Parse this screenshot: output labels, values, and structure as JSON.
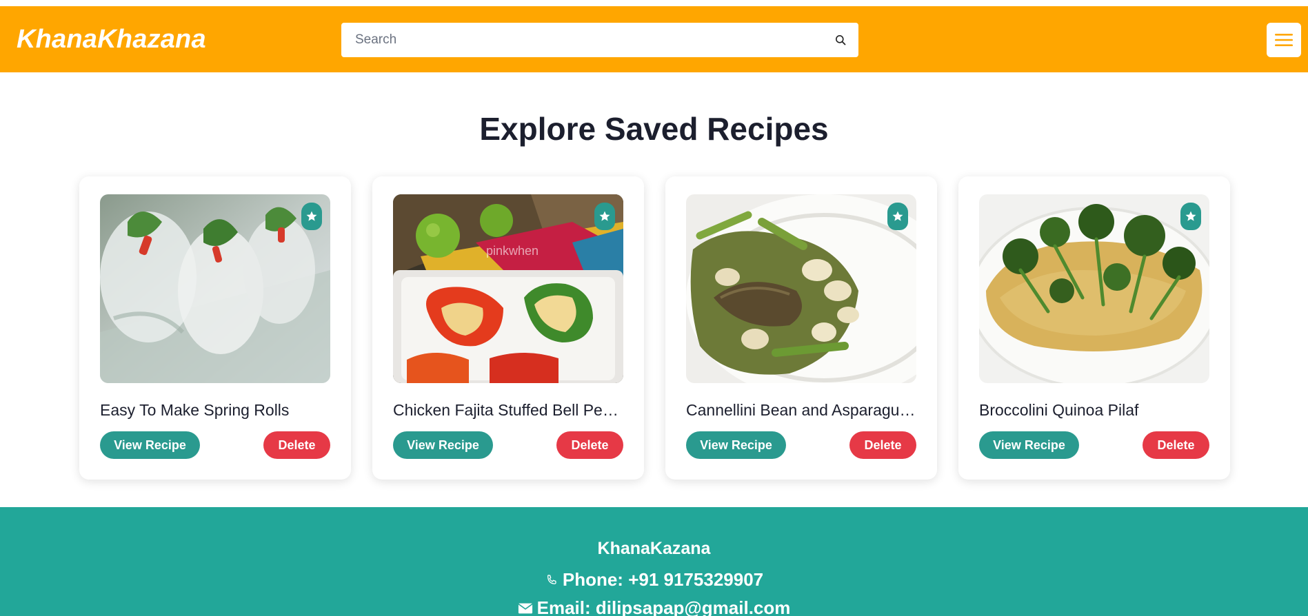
{
  "header": {
    "brand": "KhanaKhazana",
    "search_placeholder": "Search",
    "search_icon": "search-icon",
    "menu_icon": "hamburger-menu-icon"
  },
  "main": {
    "title": "Explore Saved Recipes",
    "cards": [
      {
        "title": "Easy To Make Spring Rolls",
        "view_label": "View Recipe",
        "delete_label": "Delete",
        "favorite_icon": "star-icon"
      },
      {
        "title": "Chicken Fajita Stuffed Bell Peppers",
        "view_label": "View Recipe",
        "delete_label": "Delete",
        "favorite_icon": "star-icon",
        "image_watermark": "pinkwhen"
      },
      {
        "title": "Cannellini Bean and Asparagus Salad",
        "view_label": "View Recipe",
        "delete_label": "Delete",
        "favorite_icon": "star-icon"
      },
      {
        "title": "Broccolini Quinoa Pilaf",
        "view_label": "View Recipe",
        "delete_label": "Delete",
        "favorite_icon": "star-icon"
      }
    ]
  },
  "footer": {
    "brand": "KhanaKazana",
    "phone": "Phone: +91 9175329907",
    "email": "Email: dilipsapap@gmail.com"
  },
  "colors": {
    "navbar": "#ffa600",
    "teal": "#2a9a8f",
    "footer": "#22a799",
    "delete": "#e63946",
    "title": "#1c1f2e"
  }
}
